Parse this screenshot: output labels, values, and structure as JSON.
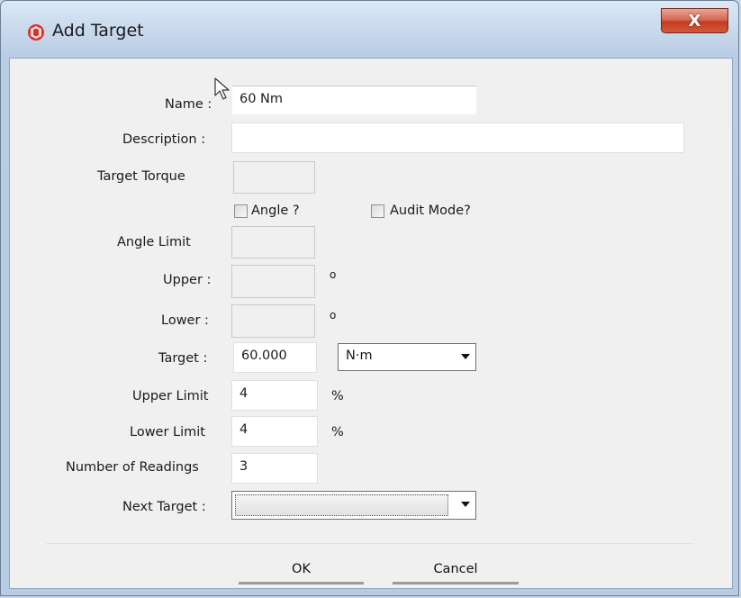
{
  "window": {
    "title": "Add Target",
    "close_label": "X"
  },
  "form": {
    "name_label": "Name :",
    "name_value": "60 Nm",
    "description_label": "Description :",
    "description_value": "",
    "target_torque_label": "Target Torque",
    "angle_checkbox_label": "Angle ?",
    "angle_checked": false,
    "audit_mode_label": "Audit Mode?",
    "audit_mode_checked": false,
    "angle_limit_label": "Angle Limit",
    "upper_label": "Upper :",
    "upper_unit": "o",
    "lower_label": "Lower :",
    "lower_unit": "o",
    "target_label": "Target :",
    "target_value": "60.000",
    "target_unit_selected": "N·m",
    "upper_limit_label": "Upper Limit",
    "upper_limit_value": "4",
    "upper_limit_unit": "%",
    "lower_limit_label": "Lower Limit",
    "lower_limit_value": "4",
    "lower_limit_unit": "%",
    "readings_label": "Number of Readings",
    "readings_value": "3",
    "next_target_label": "Next Target :",
    "next_target_selected": ""
  },
  "buttons": {
    "ok_label": "OK",
    "cancel_label": "Cancel"
  },
  "colors": {
    "titlebar": "#c5d6ea",
    "close_button": "#c13d22",
    "dialog_background": "#f0f0f0"
  }
}
